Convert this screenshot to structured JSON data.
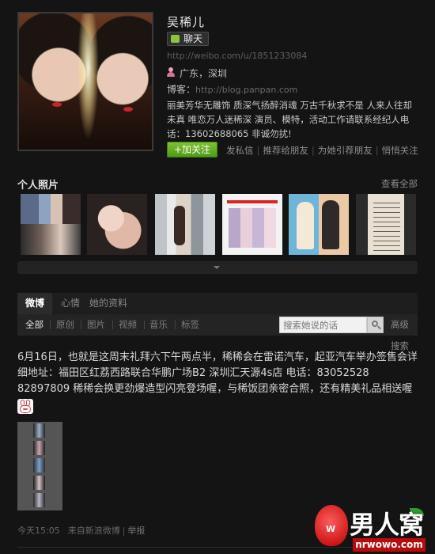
{
  "profile": {
    "name": "吴稀儿",
    "chat_label": "聊天",
    "weibo_url": "http://weibo.com/u/1851233084",
    "location": "广东，深圳",
    "blog_label": "博客：",
    "blog_url": "http://blog.panpan.com",
    "bio": "丽美芳华无雕饰 质深气扬醉消魂 万古千秋求不是 人来人往却未真 唯恋万人迷稀深 演员、模特，活动工作请联系经纪人电话：13602688065 非诚勿扰!",
    "follow_label": "+加关注",
    "actions": [
      "发私信",
      "推荐给朋友",
      "为她引荐朋友",
      "悄悄关注"
    ]
  },
  "photos": {
    "title": "个人照片",
    "view_all": "查看全部"
  },
  "tabs": {
    "items": [
      "微博",
      "心情",
      "她的资料"
    ],
    "active": 0
  },
  "filters": {
    "items": [
      "全部",
      "原创",
      "图片",
      "视频",
      "音乐",
      "标签"
    ],
    "active": 0,
    "search_placeholder": "搜索她说的话",
    "advanced_search": "高级搜索"
  },
  "post": {
    "text": "6月16日，也就是这周末礼拜六下午两点半，稀稀会在雷诺汽车，起亚汽车举办签售会详细地址：福田区红荔西路联合华鹏广场B2 深圳汇天源4s店 电话：83052528 82897809 稀稀会换更劲爆造型闪亮登场喔，与稀饭团亲密合照，还有精美礼品相送喔",
    "time": "今天15:05",
    "source": "来自新浪微博",
    "report": "举报"
  },
  "watermark": {
    "brand_cn": "男人窝",
    "url": "nrwowo.com",
    "letter": "W"
  },
  "colors": {
    "background": "#141414",
    "accent_green": "#6aab26"
  }
}
